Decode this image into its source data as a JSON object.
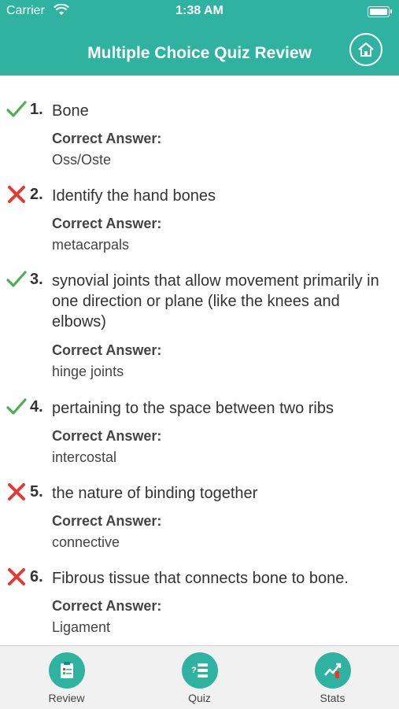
{
  "status_bar": {
    "carrier": "Carrier",
    "time": "1:38 AM"
  },
  "header": {
    "title": "Multiple Choice Quiz Review"
  },
  "answer_label": "Correct Answer:",
  "questions": [
    {
      "number": "1.",
      "result": "correct",
      "question": "Bone",
      "answer": "Oss/Oste"
    },
    {
      "number": "2.",
      "result": "incorrect",
      "question": "Identify the hand bones",
      "answer": "metacarpals"
    },
    {
      "number": "3.",
      "result": "correct",
      "question": "synovial joints that allow movement primarily in one direction or plane (like the knees and elbows)",
      "answer": "hinge joints"
    },
    {
      "number": "4.",
      "result": "correct",
      "question": "pertaining to the space between two ribs",
      "answer": "intercostal"
    },
    {
      "number": "5.",
      "result": "incorrect",
      "question": "the nature of binding together",
      "answer": "connective"
    },
    {
      "number": "6.",
      "result": "incorrect",
      "question": "Fibrous tissue that connects bone to bone.",
      "answer": "Ligament"
    }
  ],
  "tabs": [
    {
      "label": "Review",
      "icon": "review-icon"
    },
    {
      "label": "Quiz",
      "icon": "quiz-icon"
    },
    {
      "label": "Stats",
      "icon": "stats-icon"
    }
  ],
  "colors": {
    "accent": "#2fb3a0",
    "correct": "#4caf50",
    "incorrect": "#e53935"
  }
}
